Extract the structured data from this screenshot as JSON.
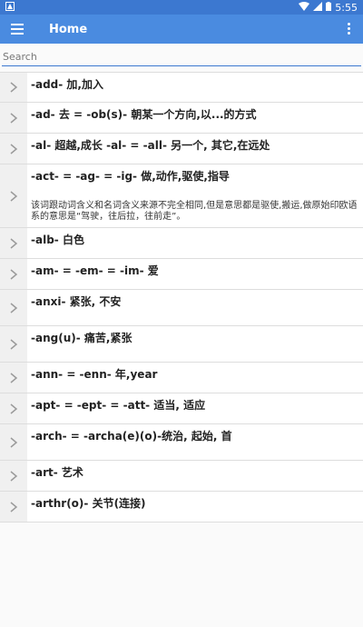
{
  "status_bar": {
    "time": "5:55",
    "icons": [
      "notification-icon",
      "wifi-icon",
      "signal-icon",
      "battery-icon"
    ]
  },
  "app_bar": {
    "title": "Home",
    "icons": [
      "menu-icon",
      "overflow-icon"
    ]
  },
  "search": {
    "placeholder": "Search",
    "value": ""
  },
  "colors": {
    "status_bar": "#3c78d0",
    "app_bar": "#4a8be0",
    "chevron_bg": "#f0f0f0",
    "divider": "#dddddd"
  },
  "items": [
    {
      "title": "-add- 加,加入",
      "desc": ""
    },
    {
      "title": "-ad- 去 = -ob(s)- 朝某一个方向,以...的方式",
      "desc": ""
    },
    {
      "title": "-al- 超越,成长 -al- = -all- 另一个, 其它,在远处",
      "desc": ""
    },
    {
      "title": "-act- = -ag- = -ig- 做,动作,驱使,指导",
      "desc": "该词跟动词含义和名词含义来源不完全相同,但是意思都是驱使,搬运,做原始印欧语系的意思是“驾驶，往后拉，往前走”。"
    },
    {
      "title": "-alb- 白色",
      "desc": ""
    },
    {
      "title": "-am- = -em- = -im- 爱",
      "desc": ""
    },
    {
      "title": "-anxi- 紧张, 不安",
      "desc": ""
    },
    {
      "title": "-ang(u)- 痛苦,紧张",
      "desc": ""
    },
    {
      "title": "-ann- = -enn- 年,year",
      "desc": ""
    },
    {
      "title": "-apt- = -ept- = -att- 适当, 适应",
      "desc": ""
    },
    {
      "title": "-arch- = -archa(e)(o)-统治, 起始, 首",
      "desc": ""
    },
    {
      "title": "-art- 艺术",
      "desc": ""
    },
    {
      "title": "-arthr(o)- 关节(连接)",
      "desc": ""
    }
  ]
}
